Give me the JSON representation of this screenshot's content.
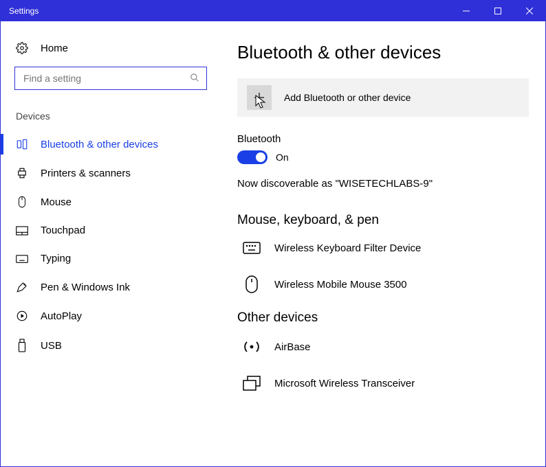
{
  "window": {
    "title": "Settings"
  },
  "sidebar": {
    "home": "Home",
    "search_placeholder": "Find a setting",
    "section": "Devices",
    "items": [
      {
        "label": "Bluetooth & other devices"
      },
      {
        "label": "Printers & scanners"
      },
      {
        "label": "Mouse"
      },
      {
        "label": "Touchpad"
      },
      {
        "label": "Typing"
      },
      {
        "label": "Pen & Windows Ink"
      },
      {
        "label": "AutoPlay"
      },
      {
        "label": "USB"
      }
    ]
  },
  "main": {
    "title": "Bluetooth & other devices",
    "add_label": "Add Bluetooth or other device",
    "bt_label": "Bluetooth",
    "bt_state": "On",
    "discover": "Now discoverable as \"WISETECHLABS-9\"",
    "sec_mouse": "Mouse, keyboard, & pen",
    "dev_keyboard": "Wireless Keyboard Filter Device",
    "dev_mouse": "Wireless Mobile Mouse 3500",
    "sec_other": "Other devices",
    "dev_airbase": "AirBase",
    "dev_transceiver": "Microsoft Wireless Transceiver"
  }
}
